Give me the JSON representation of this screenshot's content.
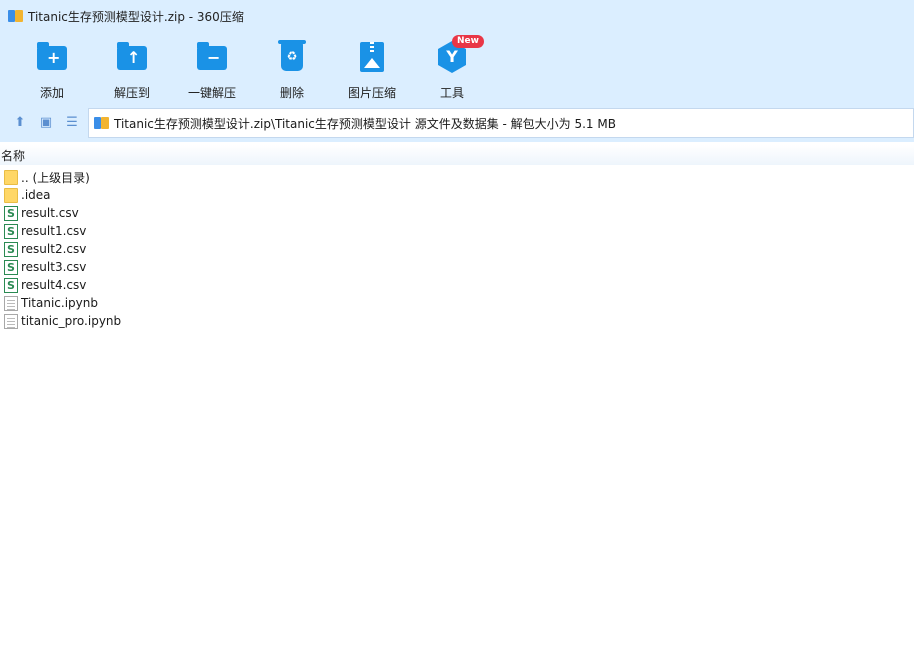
{
  "window": {
    "title": "Titanic生存预测模型设计.zip - 360压缩"
  },
  "toolbar": {
    "add_label": "添加",
    "extract_to_label": "解压到",
    "one_click_extract_label": "一键解压",
    "delete_label": "删除",
    "image_compress_label": "图片压缩",
    "tools_label": "工具",
    "tools_badge": "New"
  },
  "address": {
    "path": "Titanic生存预测模型设计.zip\\Titanic生存预测模型设计 源文件及数据集 - 解包大小为 5.1 MB"
  },
  "list": {
    "column_name": "名称",
    "items": [
      {
        "name": ".. (上级目录)",
        "type": "folder"
      },
      {
        "name": ".idea",
        "type": "folder"
      },
      {
        "name": "result.csv",
        "type": "csv"
      },
      {
        "name": "result1.csv",
        "type": "csv"
      },
      {
        "name": "result2.csv",
        "type": "csv"
      },
      {
        "name": "result3.csv",
        "type": "csv"
      },
      {
        "name": "result4.csv",
        "type": "csv"
      },
      {
        "name": "Titanic.ipynb",
        "type": "file"
      },
      {
        "name": "titanic_pro.ipynb",
        "type": "file"
      }
    ]
  },
  "colors": {
    "accent": "#1a92e6",
    "toolbar_bg": "#dbeeff",
    "badge": "#e93646"
  }
}
